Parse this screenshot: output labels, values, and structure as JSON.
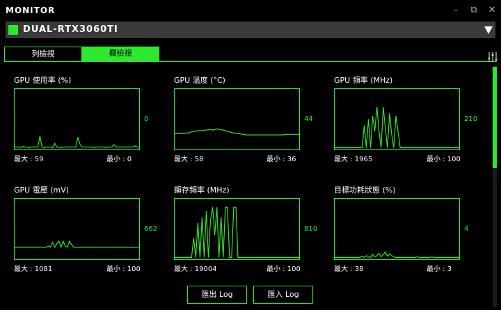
{
  "app": {
    "title": "MONITOR",
    "window_buttons": {
      "minimize": "–",
      "restore": "⧉",
      "close": "✕"
    }
  },
  "device": {
    "name": "DUAL-RTX3060TI",
    "accent": "#2ee82e"
  },
  "tabs": [
    {
      "label": "列檢視",
      "active": false
    },
    {
      "label": "欄檢視",
      "active": true
    }
  ],
  "metrics": [
    {
      "title": "GPU 使用率 (%)",
      "current": "0",
      "max": "最大 : 59",
      "min": "最小 : 0",
      "series": [
        4,
        4,
        4,
        3,
        5,
        4,
        4,
        3,
        4,
        4,
        4,
        4,
        22,
        4,
        3,
        4,
        4,
        4,
        3,
        10,
        4,
        4,
        3,
        4,
        4,
        4,
        4,
        4,
        4,
        4,
        20,
        8,
        4,
        4,
        4,
        4,
        4,
        4,
        3,
        4,
        4,
        4,
        4,
        3,
        4,
        4,
        4,
        8,
        4,
        4,
        4,
        4,
        4,
        4,
        4,
        4,
        4,
        6,
        4,
        4
      ]
    },
    {
      "title": "GPU 溫度 (°C)",
      "current": "44",
      "max": "最大 : 58",
      "min": "最小 : 36",
      "series": [
        26,
        26,
        26,
        26,
        26,
        27,
        27,
        28,
        29,
        30,
        30,
        31,
        31,
        31,
        32,
        32,
        33,
        33,
        32,
        33,
        34,
        33,
        33,
        32,
        31,
        30,
        29,
        28,
        27,
        27,
        26,
        26,
        25,
        25,
        24,
        24,
        24,
        24,
        24,
        24,
        24,
        24,
        24,
        24,
        24,
        24,
        24,
        24,
        24,
        24,
        24,
        24,
        25,
        25,
        25,
        25,
        25,
        25,
        25,
        25
      ]
    },
    {
      "title": "GPU 頻率 (MHz)",
      "current": "210",
      "max": "最大 : 1965",
      "min": "最小 : 100",
      "series": [
        3,
        3,
        3,
        3,
        3,
        3,
        3,
        3,
        3,
        3,
        3,
        3,
        3,
        3,
        40,
        3,
        50,
        3,
        55,
        30,
        70,
        30,
        3,
        70,
        35,
        3,
        60,
        25,
        3,
        55,
        30,
        3,
        3,
        3,
        3,
        3,
        3,
        3,
        3,
        3,
        3,
        3,
        3,
        3,
        3,
        3,
        3,
        3,
        3,
        3,
        3,
        3,
        3,
        3,
        3,
        3,
        3,
        3,
        3,
        3
      ]
    },
    {
      "title": "GPU 電壓 (mV)",
      "current": "662",
      "max": "最大 : 1081",
      "min": "最小 : 100",
      "series": [
        20,
        20,
        20,
        20,
        20,
        20,
        20,
        20,
        20,
        20,
        20,
        20,
        20,
        20,
        20,
        20,
        22,
        20,
        28,
        20,
        26,
        30,
        20,
        30,
        22,
        20,
        30,
        24,
        20,
        20,
        20,
        20,
        20,
        20,
        20,
        20,
        20,
        20,
        20,
        20,
        20,
        20,
        20,
        20,
        20,
        20,
        20,
        20,
        20,
        20,
        20,
        20,
        20,
        20,
        20,
        20,
        20,
        20,
        20,
        20
      ]
    },
    {
      "title": "顯存頻率 (MHz)",
      "current": "810",
      "max": "最大 : 19004",
      "min": "最小 : 100",
      "series": [
        3,
        3,
        3,
        3,
        3,
        3,
        3,
        3,
        3,
        35,
        3,
        60,
        3,
        70,
        3,
        80,
        3,
        65,
        86,
        40,
        86,
        3,
        70,
        3,
        86,
        86,
        3,
        3,
        86,
        86,
        3,
        3,
        3,
        3,
        3,
        3,
        3,
        3,
        3,
        3,
        3,
        3,
        3,
        3,
        3,
        3,
        3,
        3,
        3,
        3,
        3,
        3,
        3,
        3,
        3,
        3,
        3,
        3,
        3,
        3
      ]
    },
    {
      "title": "目標功耗狀態 (%)",
      "current": "4",
      "max": "最大 : 38",
      "min": "最小 : 3",
      "series": [
        3,
        3,
        3,
        3,
        3,
        3,
        3,
        3,
        3,
        3,
        3,
        3,
        3,
        5,
        3,
        6,
        4,
        3,
        8,
        4,
        6,
        10,
        4,
        8,
        12,
        5,
        9,
        6,
        4,
        3,
        3,
        3,
        3,
        3,
        3,
        3,
        3,
        3,
        3,
        4,
        3,
        3,
        3,
        3,
        3,
        3,
        4,
        3,
        3,
        3,
        3,
        3,
        3,
        3,
        3,
        3,
        3,
        3,
        3,
        3
      ]
    }
  ],
  "buttons": {
    "export_log": "匯出 Log",
    "import_log": "匯入 Log"
  }
}
